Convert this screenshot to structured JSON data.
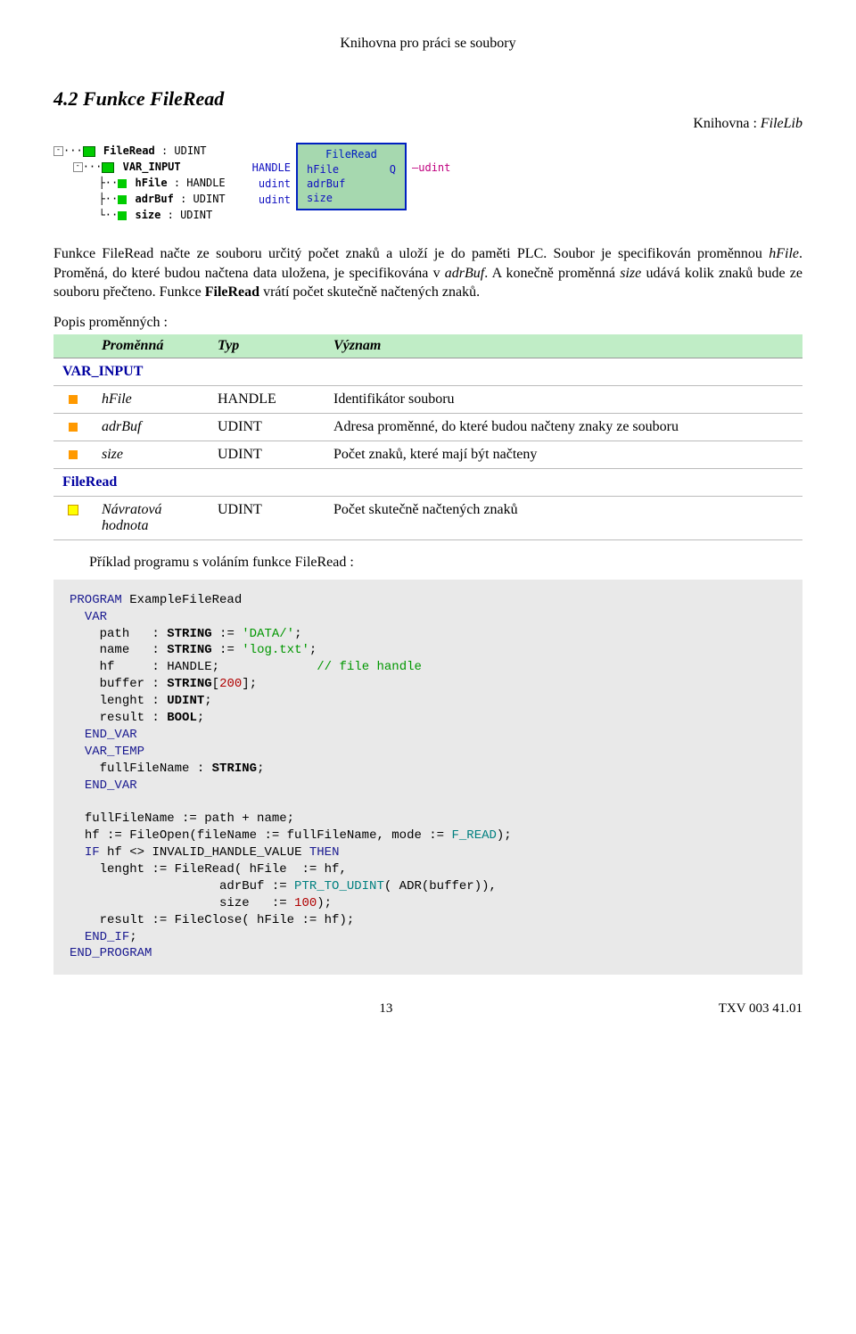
{
  "header": "Knihovna pro práci se soubory",
  "section_number": "4.2",
  "section_title": "Funkce FileRead",
  "library_prefix": "Knihovna : ",
  "library_name": "FileLib",
  "tree": {
    "root_name": "FileRead",
    "root_type": ": UDINT",
    "group": "VAR_INPUT",
    "items": [
      {
        "name": "hFile",
        "type": ": HANDLE"
      },
      {
        "name": "adrBuf",
        "type": ": UDINT"
      },
      {
        "name": "size",
        "type": ": UDINT"
      }
    ]
  },
  "block": {
    "title": "FileRead",
    "left": [
      "HANDLE",
      "udint",
      "udint"
    ],
    "inside_left": [
      "hFile",
      "adrBuf",
      "size"
    ],
    "inside_right": [
      "Q",
      "",
      ""
    ],
    "right": [
      "udint",
      "",
      ""
    ]
  },
  "paragraph_html": "Funkce FileRead načte ze souboru určitý počet znaků a uloží je do paměti PLC. Soubor je specifikován proměnnou <span class='ital'>hFile</span>. Proměná, do které budou načtena data uložena, je specifikována v <span class='ital'>adrBuf</span>. A konečně proměnná <span class='ital'>size</span> udává kolik znaků bude ze souboru přečteno. Funkce <b>FileRead</b> vrátí počet skutečně načtených znaků.",
  "vars_label": "Popis proměnných :",
  "table": {
    "headers": [
      "Proměnná",
      "Typ",
      "Význam"
    ],
    "group1": "VAR_INPUT",
    "rows1": [
      {
        "name": "hFile",
        "type": "HANDLE",
        "desc": "Identifikátor souboru"
      },
      {
        "name": "adrBuf",
        "type": "UDINT",
        "desc": "Adresa proměnné, do které budou načteny znaky ze souboru"
      },
      {
        "name": "size",
        "type": "UDINT",
        "desc": "Počet znaků, které mají být načteny"
      }
    ],
    "group2": "FileRead",
    "rows2": [
      {
        "name": "Návratová hodnota",
        "type": "UDINT",
        "desc": "Počet skutečně načtených znaků"
      }
    ]
  },
  "example_label": "Příklad programu s voláním funkce FileRead :",
  "code": {
    "line1": "PROGRAM",
    "prog_name": "ExampleFileRead",
    "k_var": "VAR",
    "v_path": "path",
    "t_string": "STRING",
    "s_data": "'DATA/'",
    "v_name": "name",
    "s_log": "'log.txt'",
    "v_hf": "hf",
    "t_handle": "HANDLE",
    "cmt_fh": "// file handle",
    "v_buffer": "buffer",
    "n_200": "200",
    "v_lenght": "lenght",
    "t_udint": "UDINT",
    "v_result": "result",
    "t_bool": "BOOL",
    "k_endvar": "END_VAR",
    "k_vartemp": "VAR_TEMP",
    "v_ffn": "fullFileName",
    "body1": "fullFileName := path + name;",
    "body2a": "hf := FileOpen(fileName := fullFileName, mode := ",
    "id_fread": "F_READ",
    "body2b": ");",
    "k_if": "IF",
    "body3": "hf <> INVALID_HANDLE_VALUE",
    "k_then": "THEN",
    "body4": "lenght := FileRead( hFile  := hf,",
    "id_ptr": "PTR_TO_UDINT",
    "body5a": "                    adrBuf := ",
    "body5b": "( ADR(buffer)),",
    "body6a": "                    size   := ",
    "n_100": "100",
    "body6b": ");",
    "body7": "result := FileClose( hFile := hf);",
    "k_endif": "END_IF",
    "k_endprog": "END_PROGRAM"
  },
  "footer": {
    "page": "13",
    "right": "TXV 003 41.01"
  }
}
